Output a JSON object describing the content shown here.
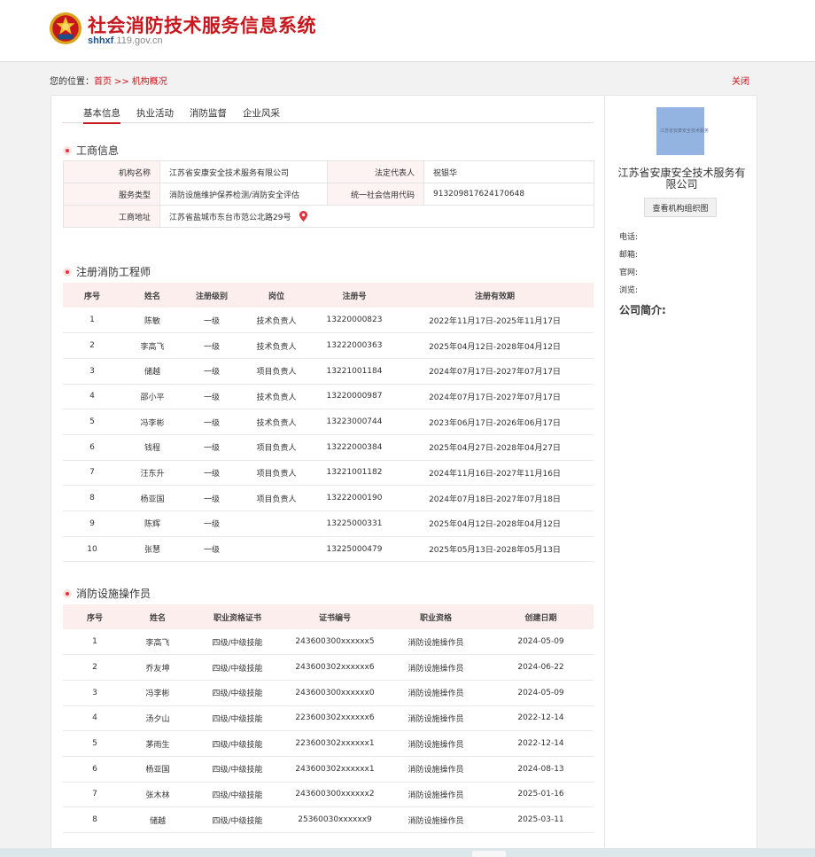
{
  "header": {
    "title": "社会消防技术服务信息系统",
    "domain_bold": "shhxf",
    "domain_rest": ".119.gov.cn"
  },
  "breadcrumb": {
    "prefix": "您的位置：",
    "home": "首页",
    "separator": ">>",
    "current": "机构概况",
    "close": "关闭"
  },
  "tabs": [
    "基本信息",
    "执业活动",
    "消防监督",
    "企业风采"
  ],
  "business": {
    "section_title": "工商信息",
    "org_name_label": "机构名称",
    "org_name": "江苏省安康安全技术服务有限公司",
    "legal_rep_label": "法定代表人",
    "legal_rep": "祝银华",
    "service_type_label": "服务类型",
    "service_type": "消防设施维护保养检测/消防安全评估",
    "credit_code_label": "统一社会信用代码",
    "credit_code": "913209817624170648",
    "address_label": "工商地址",
    "address": "江苏省盐城市东台市范公北路29号"
  },
  "engineers": {
    "section_title": "注册消防工程师",
    "columns": [
      "序号",
      "姓名",
      "注册级别",
      "岗位",
      "注册号",
      "注册有效期"
    ],
    "rows": [
      [
        "1",
        "陈敏",
        "一级",
        "技术负责人",
        "13220000823",
        "2022年11月17日-2025年11月17日"
      ],
      [
        "2",
        "李高飞",
        "一级",
        "技术负责人",
        "13222000363",
        "2025年04月12日-2028年04月12日"
      ],
      [
        "3",
        "储越",
        "一级",
        "项目负责人",
        "13221001184",
        "2024年07月17日-2027年07月17日"
      ],
      [
        "4",
        "邵小平",
        "一级",
        "技术负责人",
        "13220000987",
        "2024年07月17日-2027年07月17日"
      ],
      [
        "5",
        "冯李彬",
        "一级",
        "技术负责人",
        "13223000744",
        "2023年06月17日-2026年06月17日"
      ],
      [
        "6",
        "钱程",
        "一级",
        "项目负责人",
        "13222000384",
        "2025年04月27日-2028年04月27日"
      ],
      [
        "7",
        "汪东升",
        "一级",
        "项目负责人",
        "13221001182",
        "2024年11月16日-2027年11月16日"
      ],
      [
        "8",
        "杨亚国",
        "一级",
        "项目负责人",
        "13222000190",
        "2024年07月18日-2027年07月18日"
      ],
      [
        "9",
        "陈辉",
        "一级",
        "",
        "13225000331",
        "2025年04月12日-2028年04月12日"
      ],
      [
        "10",
        "张慧",
        "一级",
        "",
        "13225000479",
        "2025年05月13日-2028年05月13日"
      ]
    ]
  },
  "operators": {
    "section_title": "消防设施操作员",
    "columns": [
      "序号",
      "姓名",
      "职业资格证书",
      "证书编号",
      "职业资格",
      "创建日期"
    ],
    "rows": [
      [
        "1",
        "李高飞",
        "四级/中级技能",
        "243600300xxxxxx5",
        "消防设施操作员",
        "2024-05-09"
      ],
      [
        "2",
        "乔友坤",
        "四级/中级技能",
        "243600302xxxxxx6",
        "消防设施操作员",
        "2024-06-22"
      ],
      [
        "3",
        "冯李彬",
        "四级/中级技能",
        "243600300xxxxxx0",
        "消防设施操作员",
        "2024-05-09"
      ],
      [
        "4",
        "汤夕山",
        "四级/中级技能",
        "223600302xxxxxx6",
        "消防设施操作员",
        "2022-12-14"
      ],
      [
        "5",
        "茅雨生",
        "四级/中级技能",
        "223600302xxxxxx1",
        "消防设施操作员",
        "2022-12-14"
      ],
      [
        "6",
        "杨亚国",
        "四级/中级技能",
        "243600302xxxxxx1",
        "消防设施操作员",
        "2024-08-13"
      ],
      [
        "7",
        "张木林",
        "四级/中级技能",
        "243600300xxxxxx2",
        "消防设施操作员",
        "2025-01-16"
      ],
      [
        "8",
        "储越",
        "四级/中级技能",
        "25360030xxxxxx9",
        "消防设施操作员",
        "2025-03-11"
      ]
    ]
  },
  "sidebar": {
    "logo_text": "江苏省安康安全技术服务",
    "org_name": "江苏省安康安全技术服务有限公司",
    "org_chart_button": "查看机构组织图",
    "phone_label": "电话:",
    "email_label": "邮箱:",
    "website_label": "官网:",
    "views_label": "浏览:",
    "intro_label": "公司简介:"
  },
  "colors": {
    "brand_red": "#c8161d",
    "header_tint": "#fdeeee"
  }
}
